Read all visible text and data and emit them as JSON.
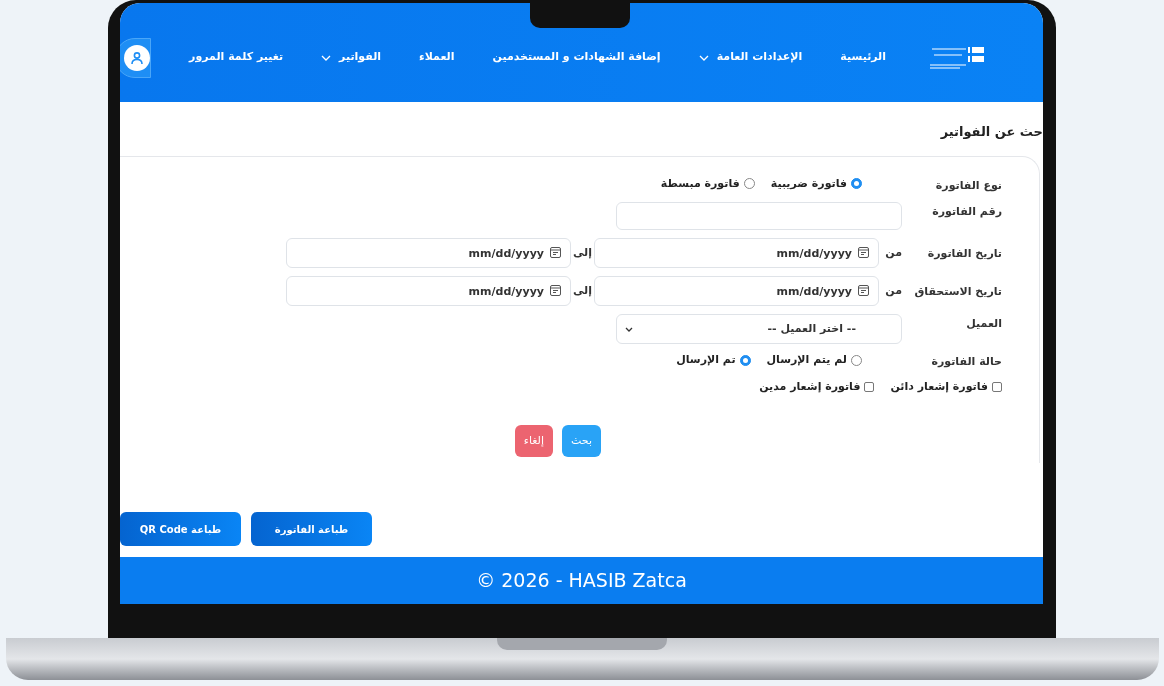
{
  "nav": {
    "items": [
      {
        "label": "الرئيسية",
        "dropdown": false
      },
      {
        "label": "الإعدادات العامة",
        "dropdown": true
      },
      {
        "label": "إضافة الشهادات و المستخدمين",
        "dropdown": false
      },
      {
        "label": "العملاء",
        "dropdown": false
      },
      {
        "label": "الفواتير",
        "dropdown": true
      },
      {
        "label": "تغيير كلمة المرور",
        "dropdown": false
      }
    ]
  },
  "page_title": "حث عن الفواتير",
  "form": {
    "rows": [
      {
        "kind": "radio",
        "label": "نوع الفاتورة",
        "options": [
          {
            "label": "فاتورة ضريبية",
            "selected": true
          },
          {
            "label": "فاتورة مبسطة",
            "selected": false
          }
        ]
      },
      {
        "kind": "text",
        "label": "رقم الفاتورة"
      },
      {
        "kind": "daterange",
        "label": "تاريخ الفاتورة",
        "from_label": "من",
        "from_placeholder": "mm/dd/yyyy",
        "to_label": "إلى",
        "to_placeholder": "mm/dd/yyyy"
      },
      {
        "kind": "daterange",
        "label": "تاريخ الاستحقاق",
        "from_label": "من",
        "from_placeholder": "mm/dd/yyyy",
        "to_label": "إلى",
        "to_placeholder": "mm/dd/yyyy"
      },
      {
        "kind": "select",
        "label": "العميل",
        "value": "-- اختر العميل --"
      },
      {
        "kind": "radio",
        "label": "حالة الفاتورة",
        "options": [
          {
            "label": "لم يتم الإرسال",
            "selected": false
          },
          {
            "label": "تم الإرسال",
            "selected": true
          }
        ]
      },
      {
        "kind": "checkboxes",
        "options": [
          {
            "label": "فاتورة إشعار دائن",
            "checked": false
          },
          {
            "label": "فاتورة إشعار مدين",
            "checked": false
          }
        ]
      }
    ],
    "actions": [
      {
        "kind": "primary",
        "label": "بحث"
      },
      {
        "kind": "danger",
        "label": "إلغاء"
      }
    ]
  },
  "print_buttons": [
    "طباعة الفاتورة",
    "طباعة QR Code"
  ],
  "footer": "© 2026 - HASIB Zatca"
}
